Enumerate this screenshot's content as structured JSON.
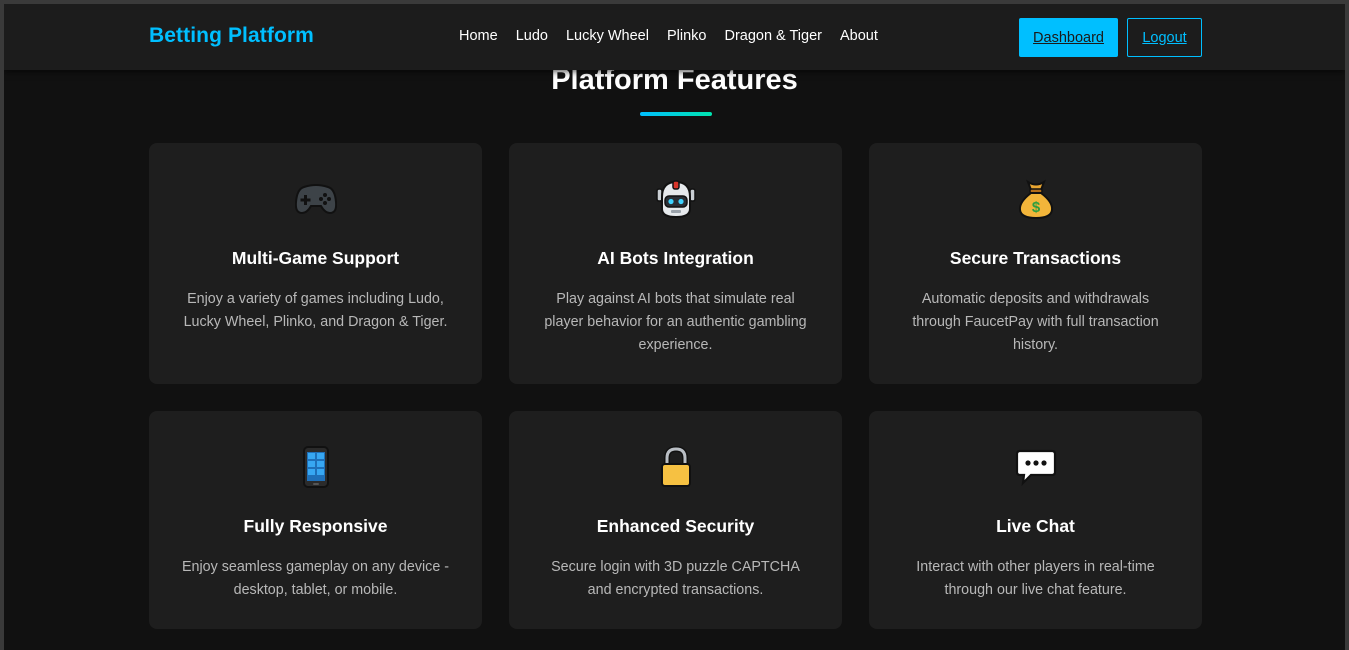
{
  "header": {
    "brand": "Betting Platform",
    "nav": [
      "Home",
      "Ludo",
      "Lucky Wheel",
      "Plinko",
      "Dragon & Tiger",
      "About"
    ],
    "dashboard_label": "Dashboard",
    "logout_label": "Logout"
  },
  "section": {
    "title": "Platform Features"
  },
  "features": [
    {
      "icon": "gamepad-icon",
      "title": "Multi-Game Support",
      "desc": "Enjoy a variety of games including Ludo, Lucky Wheel, Plinko, and Dragon & Tiger."
    },
    {
      "icon": "robot-icon",
      "title": "AI Bots Integration",
      "desc": "Play against AI bots that simulate real player behavior for an authentic gambling experience."
    },
    {
      "icon": "money-bag-icon",
      "title": "Secure Transactions",
      "desc": "Automatic deposits and withdrawals through FaucetPay with full transaction history."
    },
    {
      "icon": "mobile-phone-icon",
      "title": "Fully Responsive",
      "desc": "Enjoy seamless gameplay on any device - desktop, tablet, or mobile."
    },
    {
      "icon": "lock-icon",
      "title": "Enhanced Security",
      "desc": "Secure login with 3D puzzle CAPTCHA and encrypted transactions."
    },
    {
      "icon": "chat-bubble-icon",
      "title": "Live Chat",
      "desc": "Interact with other players in real-time through our live chat feature."
    }
  ],
  "colors": {
    "accent": "#00bfff",
    "background": "#111111",
    "card": "#1e1e1e",
    "header": "#1c1c1c"
  }
}
